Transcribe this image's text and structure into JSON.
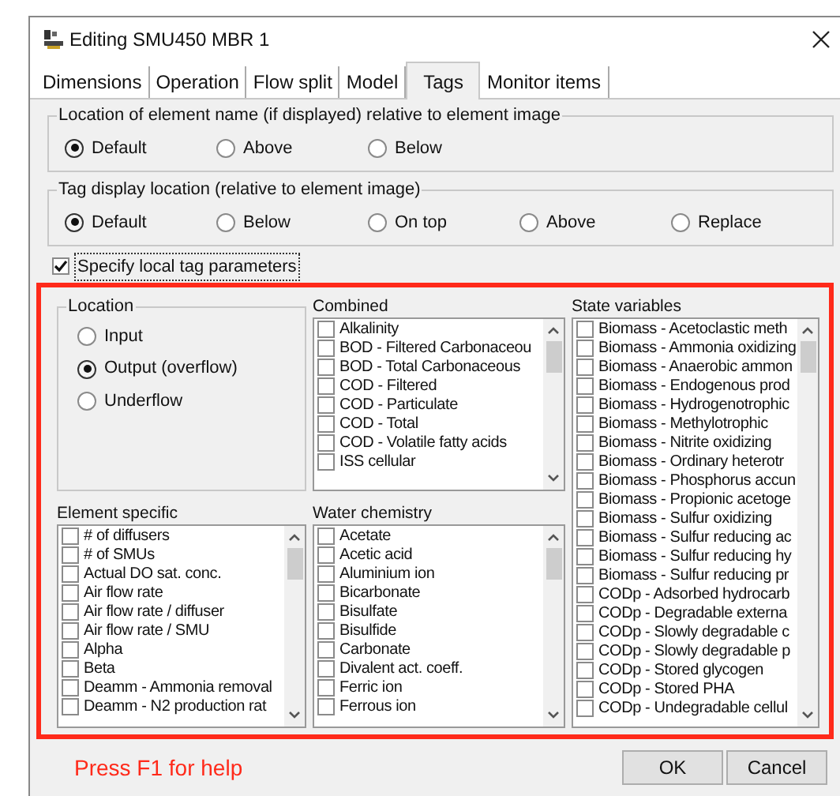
{
  "window": {
    "title": "Editing SMU450 MBR 1"
  },
  "tabs": [
    {
      "label": "Dimensions",
      "selected": false
    },
    {
      "label": "Operation",
      "selected": false
    },
    {
      "label": "Flow split",
      "selected": false
    },
    {
      "label": "Model",
      "selected": false
    },
    {
      "label": "Tags",
      "selected": true
    },
    {
      "label": "Monitor items",
      "selected": false
    }
  ],
  "name_location": {
    "legend": "Location of element name (if displayed) relative to element image",
    "options": [
      {
        "label": "Default",
        "selected": true
      },
      {
        "label": "Above",
        "selected": false
      },
      {
        "label": "Below",
        "selected": false
      }
    ]
  },
  "tag_location": {
    "legend": "Tag display location (relative to element image)",
    "options": [
      {
        "label": "Default",
        "selected": true
      },
      {
        "label": "Below",
        "selected": false
      },
      {
        "label": "On top",
        "selected": false
      },
      {
        "label": "Above",
        "selected": false
      },
      {
        "label": "Replace",
        "selected": false
      }
    ]
  },
  "local_tags": {
    "label": "Specify local tag parameters",
    "checked": true
  },
  "location": {
    "legend": "Location",
    "options": [
      {
        "label": "Input",
        "selected": false
      },
      {
        "label": "Output (overflow)",
        "selected": true
      },
      {
        "label": "Underflow",
        "selected": false
      }
    ]
  },
  "combined": {
    "title": "Combined",
    "items": [
      {
        "label": "Alkalinity",
        "checked": false
      },
      {
        "label": "BOD - Filtered Carbonaceou",
        "checked": false
      },
      {
        "label": "BOD - Total Carbonaceous",
        "checked": false
      },
      {
        "label": "COD - Filtered",
        "checked": false
      },
      {
        "label": "COD - Particulate",
        "checked": false
      },
      {
        "label": "COD - Total",
        "checked": false
      },
      {
        "label": "COD - Volatile fatty acids",
        "checked": false
      },
      {
        "label": "ISS cellular",
        "checked": false
      }
    ]
  },
  "state_variables": {
    "title": "State variables",
    "items": [
      {
        "label": "Biomass - Acetoclastic meth",
        "checked": false
      },
      {
        "label": "Biomass - Ammonia oxidizing",
        "checked": false
      },
      {
        "label": "Biomass - Anaerobic ammon",
        "checked": false
      },
      {
        "label": "Biomass - Endogenous prod",
        "checked": false
      },
      {
        "label": "Biomass - Hydrogenotrophic",
        "checked": false
      },
      {
        "label": "Biomass - Methylotrophic",
        "checked": false
      },
      {
        "label": "Biomass - Nitrite oxidizing",
        "checked": false
      },
      {
        "label": "Biomass - Ordinary heterotr",
        "checked": false
      },
      {
        "label": "Biomass - Phosphorus accun",
        "checked": false
      },
      {
        "label": "Biomass - Propionic acetoge",
        "checked": false
      },
      {
        "label": "Biomass - Sulfur oxidizing",
        "checked": false
      },
      {
        "label": "Biomass - Sulfur reducing ac",
        "checked": false
      },
      {
        "label": "Biomass - Sulfur reducing hy",
        "checked": false
      },
      {
        "label": "Biomass - Sulfur reducing pr",
        "checked": false
      },
      {
        "label": "CODp - Adsorbed hydrocarb",
        "checked": false
      },
      {
        "label": "CODp - Degradable externa",
        "checked": false
      },
      {
        "label": "CODp - Slowly degradable c",
        "checked": false
      },
      {
        "label": "CODp - Slowly degradable p",
        "checked": false
      },
      {
        "label": "CODp - Stored glycogen",
        "checked": false
      },
      {
        "label": "CODp - Stored PHA",
        "checked": false
      },
      {
        "label": "CODp - Undegradable cellul",
        "checked": false
      }
    ]
  },
  "element_specific": {
    "title": "Element specific",
    "items": [
      {
        "label": "# of diffusers",
        "checked": false
      },
      {
        "label": "# of SMUs",
        "checked": false
      },
      {
        "label": "Actual DO sat. conc.",
        "checked": false
      },
      {
        "label": "Air flow rate",
        "checked": false
      },
      {
        "label": "Air flow rate / diffuser",
        "checked": false
      },
      {
        "label": "Air flow rate / SMU",
        "checked": false
      },
      {
        "label": "Alpha",
        "checked": false
      },
      {
        "label": "Beta",
        "checked": false
      },
      {
        "label": "Deamm -  Ammonia removal",
        "checked": false
      },
      {
        "label": "Deamm - N2 production rat",
        "checked": false
      }
    ]
  },
  "water_chemistry": {
    "title": "Water chemistry",
    "items": [
      {
        "label": "Acetate",
        "checked": false
      },
      {
        "label": "Acetic acid",
        "checked": false
      },
      {
        "label": "Aluminium ion",
        "checked": false
      },
      {
        "label": "Bicarbonate",
        "checked": false
      },
      {
        "label": "Bisulfate",
        "checked": false
      },
      {
        "label": "Bisulfide",
        "checked": false
      },
      {
        "label": "Carbonate",
        "checked": false
      },
      {
        "label": "Divalent act. coeff.",
        "checked": false
      },
      {
        "label": "Ferric ion",
        "checked": false
      },
      {
        "label": "Ferrous ion",
        "checked": false
      }
    ]
  },
  "help": "Press F1 for help",
  "buttons": [
    "OK",
    "Cancel"
  ]
}
